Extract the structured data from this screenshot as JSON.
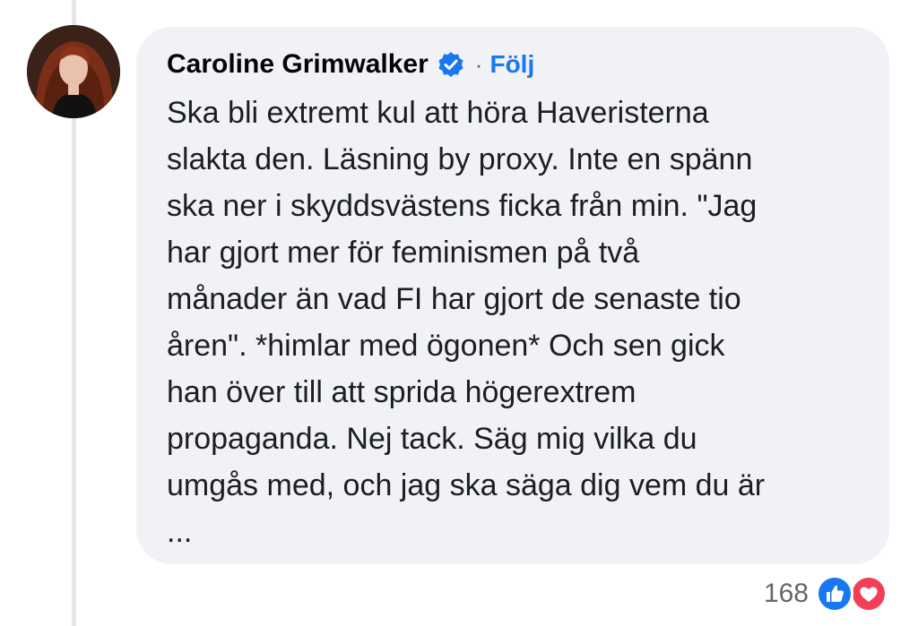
{
  "comment": {
    "author": "Caroline Grimwalker",
    "verified_icon": "verified-badge-icon",
    "separator": "·",
    "follow_label": "Följ",
    "text_lines": [
      "Ska bli extremt kul att höra Haveristerna",
      "slakta den. Läsning by proxy. Inte en spänn",
      "ska ner i skyddsvästens ficka från min. \"Jag",
      "har gjort mer för feminismen på två",
      "månader än vad FI har gjort de senaste tio",
      "åren\". *himlar med ögonen* Och sen gick",
      "han över till att sprida högerextrem",
      "propaganda. Nej tack. Säg mig vilka du",
      "umgås med, och jag ska säga dig vem du är",
      "..."
    ]
  },
  "reactions": {
    "count": "168",
    "icons": [
      "like-icon",
      "love-icon"
    ]
  },
  "colors": {
    "bubble_bg": "#f0f2f5",
    "accent": "#1877f2",
    "love": "#f33e58",
    "text": "#1c1e21",
    "muted": "#65676b"
  }
}
